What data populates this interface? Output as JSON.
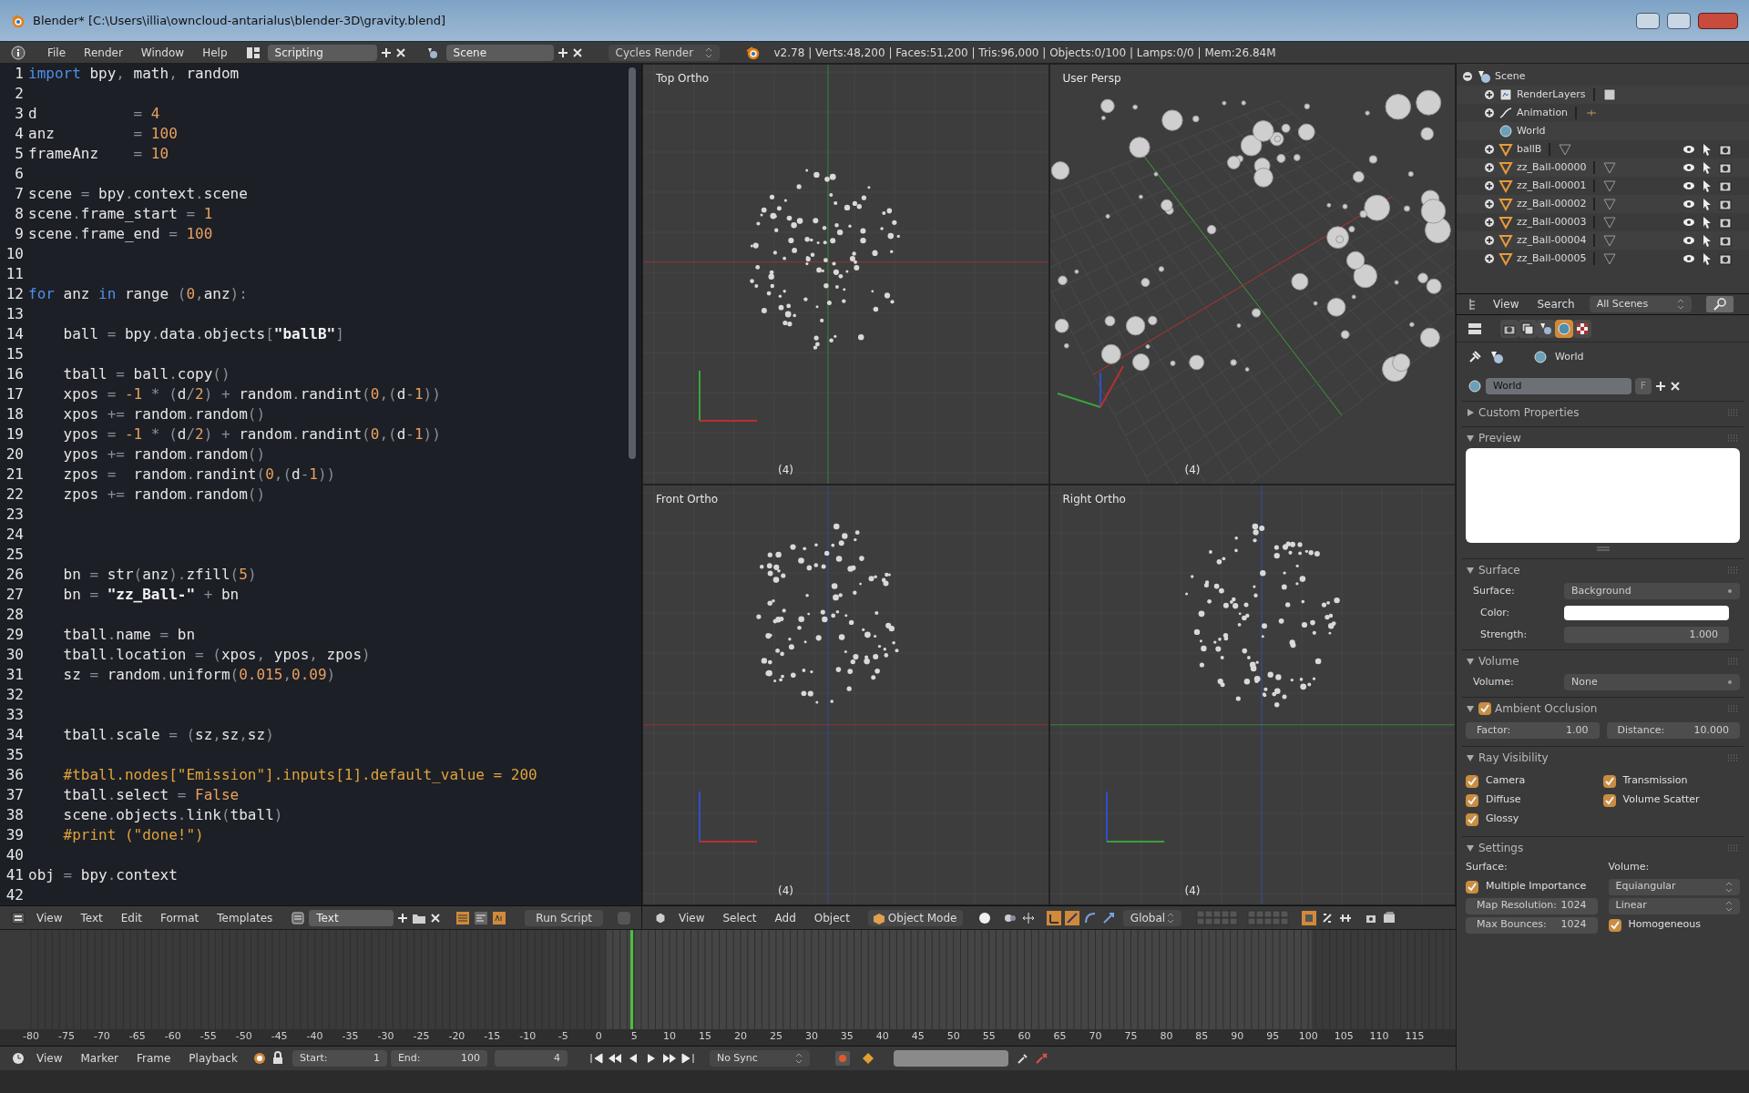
{
  "window": {
    "title": "Blender* [C:\\Users\\illia\\owncloud-antarialus\\blender-3D\\gravity.blend]"
  },
  "info_header": {
    "menus": [
      "File",
      "Render",
      "Window",
      "Help"
    ],
    "layout": "Scripting",
    "scene": "Scene",
    "engine": "Cycles Render",
    "stats": "v2.78 | Verts:48,200 | Faces:51,200 | Tris:96,000 | Objects:0/100 | Lamps:0/0 | Mem:26.84M"
  },
  "text_editor": {
    "lines": [
      {
        "number": "1",
        "parts": [
          {
            "kind": "kw",
            "text": "import"
          },
          {
            "kind": "id",
            "text": " bpy"
          },
          {
            "kind": "op",
            "text": ","
          },
          {
            "kind": "id",
            "text": " math"
          },
          {
            "kind": "op",
            "text": ","
          },
          {
            "kind": "id",
            "text": " random"
          }
        ]
      },
      {
        "number": "2"
      },
      {
        "number": "3",
        "parts": [
          {
            "kind": "id",
            "text": "d           "
          },
          {
            "kind": "op",
            "text": "= "
          },
          {
            "kind": "num",
            "text": "4"
          }
        ]
      },
      {
        "number": "4",
        "parts": [
          {
            "kind": "id",
            "text": "anz         "
          },
          {
            "kind": "op",
            "text": "= "
          },
          {
            "kind": "num",
            "text": "100"
          }
        ]
      },
      {
        "number": "5",
        "parts": [
          {
            "kind": "id",
            "text": "frameAnz    "
          },
          {
            "kind": "op",
            "text": "= "
          },
          {
            "kind": "num",
            "text": "10"
          }
        ]
      },
      {
        "number": "6"
      },
      {
        "number": "7",
        "parts": [
          {
            "kind": "id",
            "text": "scene "
          },
          {
            "kind": "op",
            "text": "= "
          },
          {
            "kind": "id",
            "text": "bpy"
          },
          {
            "kind": "op",
            "text": "."
          },
          {
            "kind": "id",
            "text": "context"
          },
          {
            "kind": "op",
            "text": "."
          },
          {
            "kind": "id",
            "text": "scene"
          }
        ]
      },
      {
        "number": "8",
        "parts": [
          {
            "kind": "id",
            "text": "scene"
          },
          {
            "kind": "op",
            "text": "."
          },
          {
            "kind": "id",
            "text": "frame_start "
          },
          {
            "kind": "op",
            "text": "= "
          },
          {
            "kind": "num",
            "text": "1"
          }
        ]
      },
      {
        "number": "9",
        "parts": [
          {
            "kind": "id",
            "text": "scene"
          },
          {
            "kind": "op",
            "text": "."
          },
          {
            "kind": "id",
            "text": "frame_end "
          },
          {
            "kind": "op",
            "text": "= "
          },
          {
            "kind": "num",
            "text": "100"
          }
        ]
      },
      {
        "number": "10"
      },
      {
        "number": "11"
      },
      {
        "number": "12",
        "parts": [
          {
            "kind": "kw",
            "text": "for"
          },
          {
            "kind": "id",
            "text": " anz "
          },
          {
            "kind": "kw",
            "text": "in"
          },
          {
            "kind": "id",
            "text": " range "
          },
          {
            "kind": "op",
            "text": "("
          },
          {
            "kind": "num",
            "text": "0"
          },
          {
            "kind": "op",
            "text": ","
          },
          {
            "kind": "id",
            "text": "anz"
          },
          {
            "kind": "op",
            "text": "):"
          }
        ]
      },
      {
        "number": "13"
      },
      {
        "number": "14",
        "parts": [
          {
            "kind": "id",
            "text": "    ball "
          },
          {
            "kind": "op",
            "text": "= "
          },
          {
            "kind": "id",
            "text": "bpy"
          },
          {
            "kind": "op",
            "text": "."
          },
          {
            "kind": "id",
            "text": "data"
          },
          {
            "kind": "op",
            "text": "."
          },
          {
            "kind": "id",
            "text": "objects"
          },
          {
            "kind": "op",
            "text": "["
          },
          {
            "kind": "str",
            "text": "\"ballB\""
          },
          {
            "kind": "op",
            "text": "]"
          }
        ]
      },
      {
        "number": "15"
      },
      {
        "number": "16",
        "parts": [
          {
            "kind": "id",
            "text": "    tball "
          },
          {
            "kind": "op",
            "text": "= "
          },
          {
            "kind": "id",
            "text": "ball"
          },
          {
            "kind": "op",
            "text": "."
          },
          {
            "kind": "id",
            "text": "copy"
          },
          {
            "kind": "op",
            "text": "()"
          }
        ]
      },
      {
        "number": "17",
        "parts": [
          {
            "kind": "id",
            "text": "    xpos "
          },
          {
            "kind": "op",
            "text": "= "
          },
          {
            "kind": "num",
            "text": "-1"
          },
          {
            "kind": "op",
            "text": " * ("
          },
          {
            "kind": "id",
            "text": "d"
          },
          {
            "kind": "op",
            "text": "/"
          },
          {
            "kind": "num",
            "text": "2"
          },
          {
            "kind": "op",
            "text": ") + "
          },
          {
            "kind": "id",
            "text": "random"
          },
          {
            "kind": "op",
            "text": "."
          },
          {
            "kind": "id",
            "text": "randint"
          },
          {
            "kind": "op",
            "text": "("
          },
          {
            "kind": "num",
            "text": "0"
          },
          {
            "kind": "op",
            "text": ",("
          },
          {
            "kind": "id",
            "text": "d"
          },
          {
            "kind": "op",
            "text": "-"
          },
          {
            "kind": "num",
            "text": "1"
          },
          {
            "kind": "op",
            "text": "))"
          }
        ]
      },
      {
        "number": "18",
        "parts": [
          {
            "kind": "id",
            "text": "    xpos "
          },
          {
            "kind": "op",
            "text": "+= "
          },
          {
            "kind": "id",
            "text": "random"
          },
          {
            "kind": "op",
            "text": "."
          },
          {
            "kind": "id",
            "text": "random"
          },
          {
            "kind": "op",
            "text": "()"
          }
        ]
      },
      {
        "number": "19",
        "parts": [
          {
            "kind": "id",
            "text": "    ypos "
          },
          {
            "kind": "op",
            "text": "= "
          },
          {
            "kind": "num",
            "text": "-1"
          },
          {
            "kind": "op",
            "text": " * ("
          },
          {
            "kind": "id",
            "text": "d"
          },
          {
            "kind": "op",
            "text": "/"
          },
          {
            "kind": "num",
            "text": "2"
          },
          {
            "kind": "op",
            "text": ") + "
          },
          {
            "kind": "id",
            "text": "random"
          },
          {
            "kind": "op",
            "text": "."
          },
          {
            "kind": "id",
            "text": "randint"
          },
          {
            "kind": "op",
            "text": "("
          },
          {
            "kind": "num",
            "text": "0"
          },
          {
            "kind": "op",
            "text": ",("
          },
          {
            "kind": "id",
            "text": "d"
          },
          {
            "kind": "op",
            "text": "-"
          },
          {
            "kind": "num",
            "text": "1"
          },
          {
            "kind": "op",
            "text": "))"
          }
        ]
      },
      {
        "number": "20",
        "parts": [
          {
            "kind": "id",
            "text": "    ypos "
          },
          {
            "kind": "op",
            "text": "+= "
          },
          {
            "kind": "id",
            "text": "random"
          },
          {
            "kind": "op",
            "text": "."
          },
          {
            "kind": "id",
            "text": "random"
          },
          {
            "kind": "op",
            "text": "()"
          }
        ]
      },
      {
        "number": "21",
        "parts": [
          {
            "kind": "id",
            "text": "    zpos "
          },
          {
            "kind": "op",
            "text": "=  "
          },
          {
            "kind": "id",
            "text": "random"
          },
          {
            "kind": "op",
            "text": "."
          },
          {
            "kind": "id",
            "text": "randint"
          },
          {
            "kind": "op",
            "text": "("
          },
          {
            "kind": "num",
            "text": "0"
          },
          {
            "kind": "op",
            "text": ",("
          },
          {
            "kind": "id",
            "text": "d"
          },
          {
            "kind": "op",
            "text": "-"
          },
          {
            "kind": "num",
            "text": "1"
          },
          {
            "kind": "op",
            "text": "))"
          }
        ]
      },
      {
        "number": "22",
        "parts": [
          {
            "kind": "id",
            "text": "    zpos "
          },
          {
            "kind": "op",
            "text": "+= "
          },
          {
            "kind": "id",
            "text": "random"
          },
          {
            "kind": "op",
            "text": "."
          },
          {
            "kind": "id",
            "text": "random"
          },
          {
            "kind": "op",
            "text": "()"
          }
        ]
      },
      {
        "number": "23"
      },
      {
        "number": "24"
      },
      {
        "number": "25"
      },
      {
        "number": "26",
        "parts": [
          {
            "kind": "id",
            "text": "    bn "
          },
          {
            "kind": "op",
            "text": "= "
          },
          {
            "kind": "id",
            "text": "str"
          },
          {
            "kind": "op",
            "text": "("
          },
          {
            "kind": "id",
            "text": "anz"
          },
          {
            "kind": "op",
            "text": ")."
          },
          {
            "kind": "id",
            "text": "zfill"
          },
          {
            "kind": "op",
            "text": "("
          },
          {
            "kind": "num",
            "text": "5"
          },
          {
            "kind": "op",
            "text": ")"
          }
        ]
      },
      {
        "number": "27",
        "parts": [
          {
            "kind": "id",
            "text": "    bn "
          },
          {
            "kind": "op",
            "text": "= "
          },
          {
            "kind": "str",
            "text": "\"zz_Ball-\""
          },
          {
            "kind": "op",
            "text": " + "
          },
          {
            "kind": "id",
            "text": "bn"
          }
        ]
      },
      {
        "number": "28"
      },
      {
        "number": "29",
        "parts": [
          {
            "kind": "id",
            "text": "    tball"
          },
          {
            "kind": "op",
            "text": "."
          },
          {
            "kind": "id",
            "text": "name "
          },
          {
            "kind": "op",
            "text": "= "
          },
          {
            "kind": "id",
            "text": "bn"
          }
        ]
      },
      {
        "number": "30",
        "parts": [
          {
            "kind": "id",
            "text": "    tball"
          },
          {
            "kind": "op",
            "text": "."
          },
          {
            "kind": "id",
            "text": "location "
          },
          {
            "kind": "op",
            "text": "= ("
          },
          {
            "kind": "id",
            "text": "xpos"
          },
          {
            "kind": "op",
            "text": ", "
          },
          {
            "kind": "id",
            "text": "ypos"
          },
          {
            "kind": "op",
            "text": ", "
          },
          {
            "kind": "id",
            "text": "zpos"
          },
          {
            "kind": "op",
            "text": ")"
          }
        ]
      },
      {
        "number": "31",
        "parts": [
          {
            "kind": "id",
            "text": "    sz "
          },
          {
            "kind": "op",
            "text": "= "
          },
          {
            "kind": "id",
            "text": "random"
          },
          {
            "kind": "op",
            "text": "."
          },
          {
            "kind": "id",
            "text": "uniform"
          },
          {
            "kind": "op",
            "text": "("
          },
          {
            "kind": "num",
            "text": "0.015"
          },
          {
            "kind": "op",
            "text": ","
          },
          {
            "kind": "num",
            "text": "0.09"
          },
          {
            "kind": "op",
            "text": ")"
          }
        ]
      },
      {
        "number": "32"
      },
      {
        "number": "33"
      },
      {
        "number": "34",
        "parts": [
          {
            "kind": "id",
            "text": "    tball"
          },
          {
            "kind": "op",
            "text": "."
          },
          {
            "kind": "id",
            "text": "scale "
          },
          {
            "kind": "op",
            "text": "= ("
          },
          {
            "kind": "id",
            "text": "sz"
          },
          {
            "kind": "op",
            "text": ","
          },
          {
            "kind": "id",
            "text": "sz"
          },
          {
            "kind": "op",
            "text": ","
          },
          {
            "kind": "id",
            "text": "sz"
          },
          {
            "kind": "op",
            "text": ")"
          }
        ]
      },
      {
        "number": "35"
      },
      {
        "number": "36",
        "parts": [
          {
            "kind": "com",
            "text": "    #tball.nodes[\"Emission\"].inputs[1].default_value = 200"
          }
        ]
      },
      {
        "number": "37",
        "parts": [
          {
            "kind": "id",
            "text": "    tball"
          },
          {
            "kind": "op",
            "text": "."
          },
          {
            "kind": "id",
            "text": "select "
          },
          {
            "kind": "op",
            "text": "= "
          },
          {
            "kind": "num",
            "text": "False"
          }
        ]
      },
      {
        "number": "38",
        "parts": [
          {
            "kind": "id",
            "text": "    scene"
          },
          {
            "kind": "op",
            "text": "."
          },
          {
            "kind": "id",
            "text": "objects"
          },
          {
            "kind": "op",
            "text": "."
          },
          {
            "kind": "id",
            "text": "link"
          },
          {
            "kind": "op",
            "text": "("
          },
          {
            "kind": "id",
            "text": "tball"
          },
          {
            "kind": "op",
            "text": ")"
          }
        ]
      },
      {
        "number": "39",
        "parts": [
          {
            "kind": "com",
            "text": "    #print (\"done!\")"
          }
        ]
      },
      {
        "number": "40"
      },
      {
        "number": "41",
        "parts": [
          {
            "kind": "id",
            "text": "obj "
          },
          {
            "kind": "op",
            "text": "= "
          },
          {
            "kind": "id",
            "text": "bpy"
          },
          {
            "kind": "op",
            "text": "."
          },
          {
            "kind": "id",
            "text": "context"
          }
        ]
      },
      {
        "number": "42"
      }
    ],
    "header": {
      "menus": [
        "View",
        "Text",
        "Edit",
        "Format",
        "Templates"
      ],
      "text_name": "Text",
      "run_button": "Run Script",
      "register_checked": false
    }
  },
  "viewports": [
    {
      "label": "Top Ortho",
      "frame": "(4)",
      "kind": "top"
    },
    {
      "label": "User Persp",
      "frame": "(4)",
      "kind": "persp"
    },
    {
      "label": "Front Ortho",
      "frame": "(4)",
      "kind": "front"
    },
    {
      "label": "Right Ortho",
      "frame": "(4)",
      "kind": "right"
    }
  ],
  "view3d_header": {
    "menus": [
      "View",
      "Select",
      "Add",
      "Object"
    ],
    "mode": "Object Mode",
    "orientation": "Global"
  },
  "timeline": {
    "ticks": [
      "-80",
      "-75",
      "-70",
      "-65",
      "-60",
      "-55",
      "-50",
      "-45",
      "-40",
      "-35",
      "-30",
      "-25",
      "-20",
      "-15",
      "-10",
      "-5",
      "0",
      "5",
      "10",
      "15",
      "20",
      "25",
      "30",
      "35",
      "40",
      "45",
      "50",
      "55",
      "60",
      "65",
      "70",
      "75",
      "80",
      "85",
      "90",
      "95",
      "100",
      "105",
      "110",
      "115"
    ],
    "playhead": {
      "level": 0.433
    },
    "header": {
      "menus": [
        "View",
        "Marker",
        "Frame",
        "Playback"
      ],
      "start": {
        "label": "Start:",
        "value": "1"
      },
      "end": {
        "label": "End:",
        "value": "100"
      },
      "current": "4",
      "sync": "No Sync"
    }
  },
  "outliner": {
    "items": [
      {
        "name": "Scene",
        "kind": "scene",
        "expanded": true,
        "children": [
          {
            "name": "RenderLayers",
            "kind": "renderlayers",
            "expanded": false
          },
          {
            "name": "Animation",
            "kind": "animation",
            "expanded": false
          },
          {
            "name": "World",
            "kind": "world"
          },
          {
            "name": "ballB",
            "kind": "mesh",
            "expanded": false
          },
          {
            "name": "zz_Ball-00000",
            "kind": "mesh",
            "expanded": false
          },
          {
            "name": "zz_Ball-00001",
            "kind": "mesh",
            "expanded": false
          },
          {
            "name": "zz_Ball-00002",
            "kind": "mesh",
            "expanded": false
          },
          {
            "name": "zz_Ball-00003",
            "kind": "mesh",
            "expanded": false
          },
          {
            "name": "zz_Ball-00004",
            "kind": "mesh",
            "expanded": false
          },
          {
            "name": "zz_Ball-00005",
            "kind": "mesh",
            "expanded": false
          }
        ]
      }
    ],
    "header": {
      "menus": [
        "View",
        "Search"
      ],
      "filter": "All Scenes"
    }
  },
  "properties": {
    "tabs": [
      {
        "kind": "render",
        "selected": false
      },
      {
        "kind": "layers",
        "selected": false
      },
      {
        "kind": "scene",
        "selected": false
      },
      {
        "kind": "world",
        "selected": true
      },
      {
        "kind": "texture",
        "selected": false
      }
    ],
    "context": "World",
    "datablock": {
      "value": "World",
      "fake_user": "F"
    },
    "panels": [
      {
        "title": "Custom Properties",
        "expanded": false
      },
      {
        "title": "Preview",
        "expanded": true,
        "rows": [
          {
            "kind": "preview"
          }
        ]
      },
      {
        "title": "Surface",
        "expanded": true,
        "rows": [
          {
            "kind": "dropdown",
            "label": "Surface:",
            "value": "Background"
          },
          {
            "kind": "color",
            "label": "Color:",
            "color": "#ffffff"
          },
          {
            "kind": "number",
            "label": "Strength:",
            "value": "1.000"
          }
        ]
      },
      {
        "title": "Volume",
        "expanded": true,
        "rows": [
          {
            "kind": "dropdown",
            "label": "Volume:",
            "value": "None"
          }
        ]
      },
      {
        "title": "Ambient Occlusion",
        "expanded": true,
        "checked": true,
        "rows": [
          {
            "kind": "pair",
            "items": [
              {
                "label": "Factor:",
                "value": "1.00"
              },
              {
                "label": "Distance:",
                "value": "10.000"
              }
            ]
          }
        ]
      },
      {
        "title": "Ray Visibility",
        "expanded": true,
        "rows": [
          {
            "kind": "checks",
            "items": [
              {
                "label": "Camera",
                "checked": true
              },
              {
                "label": "Transmission",
                "checked": true
              },
              {
                "label": "Diffuse",
                "checked": true
              },
              {
                "label": "Volume Scatter",
                "checked": true
              },
              {
                "label": "Glossy",
                "checked": true
              }
            ]
          }
        ]
      },
      {
        "title": "Settings",
        "expanded": true,
        "rows": [
          {
            "kind": "columns",
            "columns": [
              [
                {
                  "kind": "heading",
                  "label": "Surface:"
                },
                {
                  "kind": "check",
                  "label": "Multiple Importance",
                  "checked": true
                },
                {
                  "kind": "numfield",
                  "label": "Map Resolution:",
                  "value": "1024"
                },
                {
                  "kind": "numfield",
                  "label": "Max Bounces:",
                  "value": "1024"
                }
              ],
              [
                {
                  "kind": "heading",
                  "label": "Volume:"
                },
                {
                  "kind": "select",
                  "value": "Equiangular"
                },
                {
                  "kind": "select",
                  "value": "Linear"
                },
                {
                  "kind": "check",
                  "label": "Homogeneous",
                  "checked": true
                }
              ]
            ]
          }
        ]
      }
    ]
  }
}
